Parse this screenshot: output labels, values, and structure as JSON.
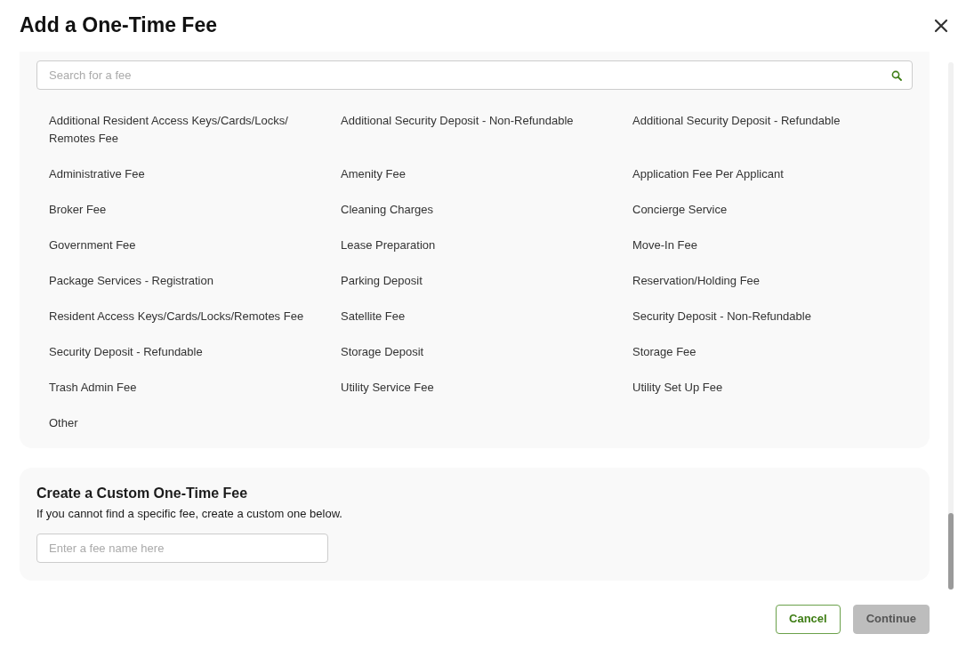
{
  "window": {
    "title": "Add a One-Time Fee"
  },
  "search": {
    "placeholder": "Search for a fee"
  },
  "fees": [
    "Additional Resident Access Keys/Cards/Locks/ Remotes Fee",
    "Additional Security Deposit - Non-Refundable",
    "Additional Security Deposit - Refundable",
    "Administrative Fee",
    "Amenity Fee",
    "Application Fee Per Applicant",
    "Broker Fee",
    "Cleaning Charges",
    "Concierge Service",
    "Government Fee",
    "Lease Preparation",
    "Move-In Fee",
    "Package Services - Registration",
    "Parking Deposit",
    "Reservation/Holding Fee",
    "Resident Access Keys/Cards/Locks/Remotes Fee",
    "Satellite Fee",
    "Security Deposit - Non-Refundable",
    "Security Deposit - Refundable",
    "Storage Deposit",
    "Storage Fee",
    "Trash Admin Fee",
    "Utility Service Fee",
    "Utility Set Up Fee",
    "Other"
  ],
  "custom": {
    "title": "Create a Custom One-Time Fee",
    "description": "If you cannot find a specific fee, create a custom one below.",
    "placeholder": "Enter a fee name here"
  },
  "buttons": [
    {
      "label": "Cancel",
      "kind": "outline",
      "disabled": false
    },
    {
      "label": "Continue",
      "kind": "primary",
      "disabled": true
    }
  ]
}
